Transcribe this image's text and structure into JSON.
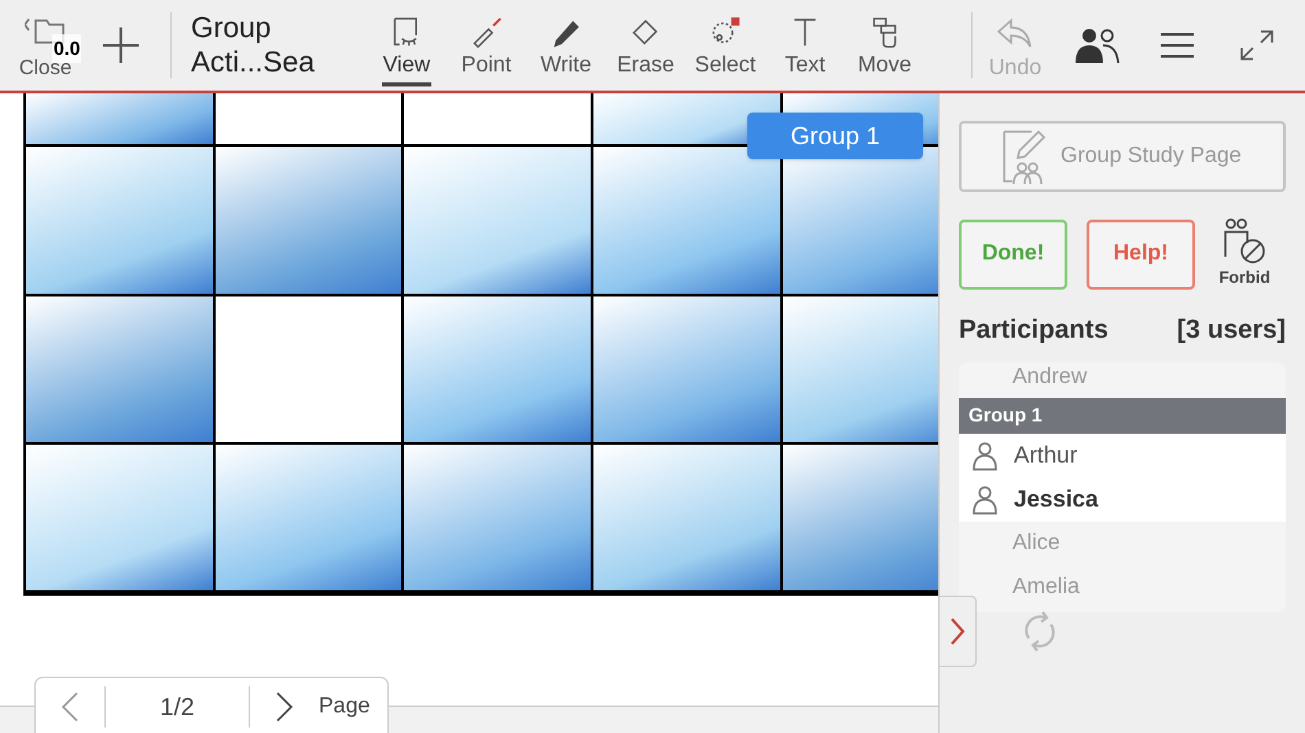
{
  "toolbar": {
    "close": {
      "label": "Close",
      "badge": "0.0"
    },
    "title": "Group Acti...Sea",
    "tools": [
      {
        "kind": "view",
        "label": "View",
        "selected": true
      },
      {
        "kind": "point",
        "label": "Point",
        "selected": false
      },
      {
        "kind": "write",
        "label": "Write",
        "selected": false
      },
      {
        "kind": "erase",
        "label": "Erase",
        "selected": false
      },
      {
        "kind": "select",
        "label": "Select",
        "selected": false
      },
      {
        "kind": "text",
        "label": "Text",
        "selected": false
      },
      {
        "kind": "move",
        "label": "Move",
        "selected": false
      }
    ],
    "undo": {
      "label": "Undo",
      "disabled": true
    }
  },
  "board": {
    "group_tag": "Group 1",
    "rows": [
      [
        {
          "kind": "drawing"
        },
        {
          "kind": "empty"
        },
        {
          "kind": "empty"
        },
        {
          "kind": "drawing"
        },
        {
          "kind": "drawing"
        }
      ],
      [
        {
          "kind": "drawing"
        },
        {
          "kind": "drawing"
        },
        {
          "kind": "drawing"
        },
        {
          "kind": "drawing"
        },
        {
          "kind": "drawing"
        }
      ],
      [
        {
          "kind": "drawing"
        },
        {
          "kind": "empty"
        },
        {
          "kind": "drawing"
        },
        {
          "kind": "drawing"
        },
        {
          "kind": "drawing"
        }
      ],
      [
        {
          "kind": "drawing"
        },
        {
          "kind": "drawing"
        },
        {
          "kind": "drawing"
        },
        {
          "kind": "drawing"
        },
        {
          "kind": "drawing"
        }
      ]
    ]
  },
  "pager": {
    "page": "1/2",
    "label": "Page"
  },
  "sidebar": {
    "study_button": "Group Study Page",
    "done": "Done!",
    "help": "Help!",
    "forbid": "Forbid",
    "participants": {
      "title": "Participants",
      "count": "[3 users]",
      "items": [
        {
          "kind": "other",
          "name": "Andrew"
        },
        {
          "kind": "group",
          "name": "Group 1"
        },
        {
          "kind": "member",
          "name": "Arthur",
          "selected": false
        },
        {
          "kind": "member",
          "name": "Jessica",
          "selected": true
        },
        {
          "kind": "other",
          "name": "Alice"
        },
        {
          "kind": "other",
          "name": "Amelia"
        }
      ]
    }
  }
}
